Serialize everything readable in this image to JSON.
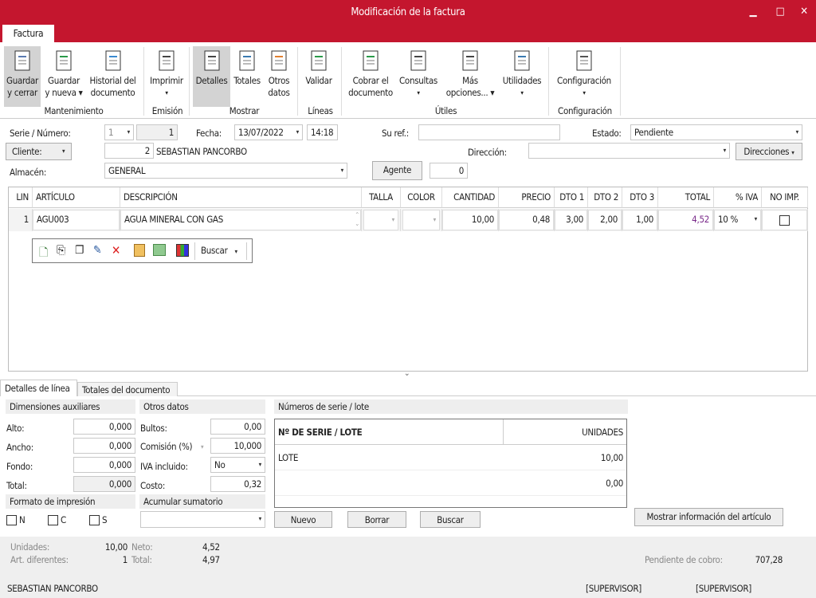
{
  "window": {
    "title": "Modificación de la factura",
    "tab": "Factura"
  },
  "ribbon": {
    "buttons": [
      {
        "label1": "Guardar",
        "label2": "y cerrar",
        "icon": "save-close-icon"
      },
      {
        "label1": "Guardar",
        "label2": "y nueva ▾",
        "icon": "save-new-icon"
      },
      {
        "label1": "Historial del",
        "label2": "documento",
        "icon": "history-icon"
      },
      {
        "label1": "Imprimir",
        "label2": "▾",
        "icon": "printer-icon"
      },
      {
        "label1": "Detalles",
        "label2": "",
        "icon": "details-icon"
      },
      {
        "label1": "Totales",
        "label2": "",
        "icon": "totals-icon"
      },
      {
        "label1": "Otros",
        "label2": "datos",
        "icon": "other-data-icon"
      },
      {
        "label1": "Validar",
        "label2": "",
        "icon": "validate-icon"
      },
      {
        "label1": "Cobrar el",
        "label2": "documento",
        "icon": "charge-icon"
      },
      {
        "label1": "Consultas",
        "label2": "▾",
        "icon": "queries-icon"
      },
      {
        "label1": "Más",
        "label2": "opciones... ▾",
        "icon": "mobile-icon"
      },
      {
        "label1": "Utilidades",
        "label2": "▾",
        "icon": "calculator-icon"
      },
      {
        "label1": "Configuración",
        "label2": "▾",
        "icon": "gear-icon"
      }
    ],
    "groups": [
      "Mantenimiento",
      "Emisión",
      "Mostrar",
      "Líneas",
      "Útiles",
      "Configuración"
    ]
  },
  "header": {
    "serie_label": "Serie / Número:",
    "serie": "1",
    "numero": "1",
    "fecha_label": "Fecha:",
    "fecha": "13/07/2022",
    "hora": "14:18",
    "suref_label": "Su ref.:",
    "suref": "",
    "estado_label": "Estado:",
    "estado": "Pendiente",
    "cliente_label": "Cliente:",
    "cliente_code": "2",
    "cliente_name": "SEBASTIAN PANCORBO",
    "direccion_label": "Dirección:",
    "direccion": "",
    "direcciones_button": "Direcciones",
    "almacen_label": "Almacén:",
    "almacen": "GENERAL",
    "agente_button": "Agente",
    "agente": "0"
  },
  "grid": {
    "columns": [
      "LIN",
      "ARTÍCULO",
      "DESCRIPCIÓN",
      "TALLA",
      "COLOR",
      "CANTIDAD",
      "PRECIO",
      "DTO 1",
      "DTO 2",
      "DTO 3",
      "TOTAL",
      "% IVA",
      "NO IMP."
    ],
    "rows": [
      {
        "lin": "1",
        "articulo": "AGU003",
        "descripcion": "AGUA MINERAL CON GAS",
        "talla": "",
        "color": "",
        "cantidad": "10,00",
        "precio": "0,48",
        "dto1": "3,00",
        "dto2": "2,00",
        "dto3": "1,00",
        "total": "4,52",
        "iva": "10 %",
        "noimp": false
      }
    ],
    "toolbar": {
      "search": "Buscar"
    }
  },
  "tabs": [
    "Detalles de línea",
    "Totales del documento"
  ],
  "details": {
    "dim_title": "Dimensiones auxiliares",
    "alto_label": "Alto:",
    "alto": "0,000",
    "ancho_label": "Ancho:",
    "ancho": "0,000",
    "fondo_label": "Fondo:",
    "fondo": "0,000",
    "total_label": "Total:",
    "total": "0,000",
    "otros_title": "Otros datos",
    "bultos_label": "Bultos:",
    "bultos": "0,00",
    "comision_label": "Comisión (%)",
    "comision": "10,000",
    "iva_label": "IVA incluido:",
    "iva": "No",
    "costo_label": "Costo:",
    "costo": "0,32",
    "formato_title": "Formato de impresión",
    "formato": [
      "N",
      "C",
      "S"
    ],
    "acumular_title": "Acumular sumatorio",
    "acumular": "",
    "serie_title": "Números de serie / lote",
    "serie_cols": [
      "Nº DE SERIE / LOTE",
      "UNIDADES"
    ],
    "serie_rows": [
      {
        "lote": "LOTE",
        "unidades": "10,00"
      },
      {
        "lote": "",
        "unidades": "0,00"
      }
    ],
    "nuevo": "Nuevo",
    "borrar": "Borrar",
    "buscar": "Buscar",
    "mostrar_info": "Mostrar información del artículo"
  },
  "footer": {
    "unidades_label": "Unidades:",
    "unidades": "10,00",
    "art_label": "Art. diferentes:",
    "art": "1",
    "neto_label": "Neto:",
    "neto": "4,52",
    "total_label": "Total:",
    "total": "4,97",
    "pendiente_label": "Pendiente de cobro:",
    "pendiente": "707,28",
    "status_user": "SEBASTIAN PANCORBO",
    "status1": "[SUPERVISOR]",
    "status2": "[SUPERVISOR]"
  },
  "colors": {
    "accent": "#c4162e",
    "total_text": "#7a2a8a"
  }
}
